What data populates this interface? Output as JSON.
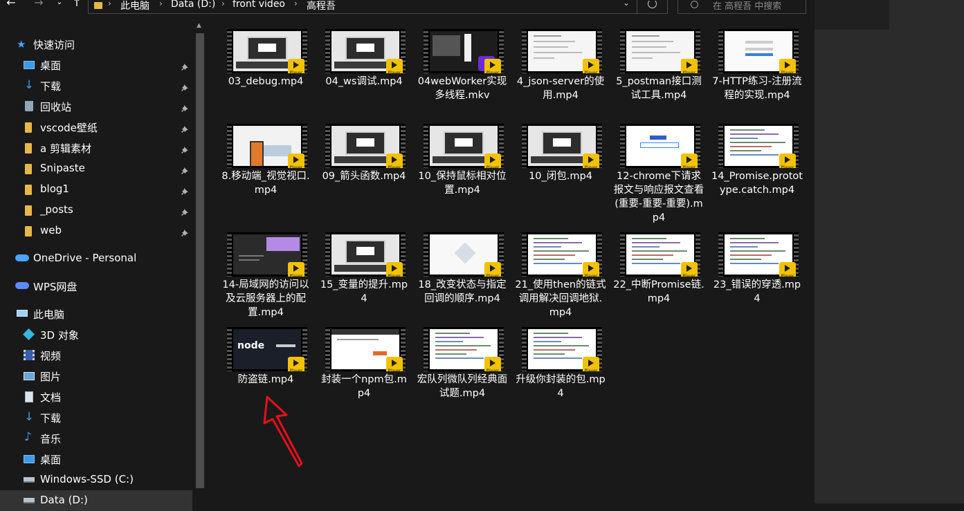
{
  "address_bar": {
    "crumbs": [
      "此电脑",
      "Data (D:)",
      "front video",
      "高程吾"
    ],
    "search_placeholder": "在 高程吾 中搜索"
  },
  "sidebar": {
    "quick_access": "快速访问",
    "pinned": [
      {
        "label": "桌面",
        "icon": "desktop-icon"
      },
      {
        "label": "下载",
        "icon": "download-icon"
      },
      {
        "label": "回收站",
        "icon": "recycle-bin-icon"
      },
      {
        "label": "vscode壁纸",
        "icon": "folder-icon"
      },
      {
        "label": "a 剪辑素材",
        "icon": "folder-icon"
      },
      {
        "label": "Snipaste",
        "icon": "folder-icon"
      },
      {
        "label": "blog1",
        "icon": "folder-icon"
      },
      {
        "label": "_posts",
        "icon": "folder-icon"
      },
      {
        "label": "web",
        "icon": "folder-icon"
      }
    ],
    "onedrive": "OneDrive - Personal",
    "wps": "WPS网盘",
    "this_pc": "此电脑",
    "pc_items": [
      {
        "label": "3D 对象",
        "icon": "3d-objects-icon"
      },
      {
        "label": "视频",
        "icon": "videos-icon"
      },
      {
        "label": "图片",
        "icon": "pictures-icon"
      },
      {
        "label": "文档",
        "icon": "documents-icon"
      },
      {
        "label": "下载",
        "icon": "download-icon"
      },
      {
        "label": "音乐",
        "icon": "music-icon"
      },
      {
        "label": "桌面",
        "icon": "desktop-icon"
      },
      {
        "label": "Windows-SSD (C:)",
        "icon": "drive-icon"
      },
      {
        "label": "Data (D:)",
        "icon": "drive-icon"
      }
    ]
  },
  "badge_text": "Player",
  "files": [
    {
      "name": "03_debug.mp4",
      "thumb": "screen"
    },
    {
      "name": "04_ws调试.mp4",
      "thumb": "screen"
    },
    {
      "name": "04webWorker实现多线程.mkv",
      "thumb": "dark-player"
    },
    {
      "name": "4_json-server的使用.mp4",
      "thumb": "doc"
    },
    {
      "name": "5_postman接口测试工具.mp4",
      "thumb": "doc"
    },
    {
      "name": "7-HTTP练习-注册流程的实现.mp4",
      "thumb": "login"
    },
    {
      "name": "8.移动端_视觉视口.mp4",
      "thumb": "mobile"
    },
    {
      "name": "09_箭头函数.mp4",
      "thumb": "screen"
    },
    {
      "name": "10_保持鼠标相对位置.mp4",
      "thumb": "screen"
    },
    {
      "name": "10_闭包.mp4",
      "thumb": "screen"
    },
    {
      "name": "12-chrome下请求报文与响应报文查看(重要-重要-重要).mp4",
      "thumb": "baidu"
    },
    {
      "name": "14_Promise.prototype.catch.mp4",
      "thumb": "code"
    },
    {
      "name": "14-局域网的访问以及云服务器上的配置.mp4",
      "thumb": "dark-code"
    },
    {
      "name": "15_变量的提升.mp4",
      "thumb": "screen"
    },
    {
      "name": "18_改变状态与指定回调的顺序.mp4",
      "thumb": "vscode"
    },
    {
      "name": "21_使用then的链式调用解决回调地狱.mp4",
      "thumb": "code"
    },
    {
      "name": "22_中断Promise链.mp4",
      "thumb": "code"
    },
    {
      "name": "23_错误的穿透.mp4",
      "thumb": "code"
    },
    {
      "name": "防盗链.mp4",
      "thumb": "node"
    },
    {
      "name": "封装一个npm包.mp4",
      "thumb": "web"
    },
    {
      "name": "宏队列微队列经典面试题.mp4",
      "thumb": "code"
    },
    {
      "name": "升级你封装的包.mp4",
      "thumb": "code"
    }
  ]
}
